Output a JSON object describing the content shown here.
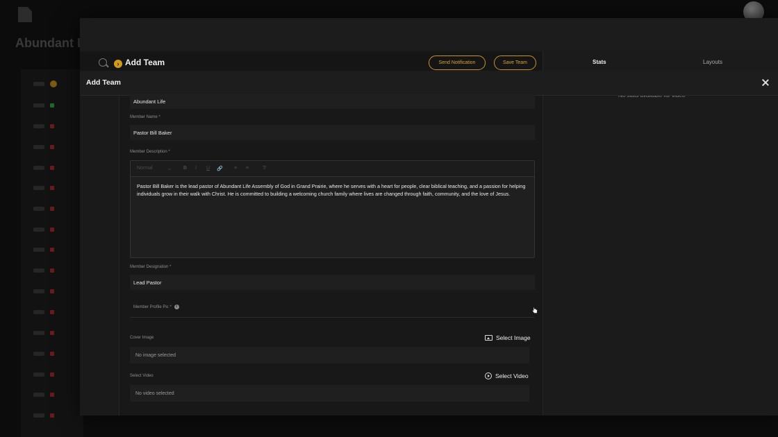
{
  "background": {
    "title": "Abundant Li",
    "list_numbers": [
      "",
      "",
      "",
      "",
      "",
      "",
      "",
      "",
      "",
      "",
      "",
      "",
      "",
      "",
      "",
      ""
    ]
  },
  "modal": {
    "page_title": "Add Team",
    "buttons": {
      "send_notification": "Send Notification",
      "save_team": "Save Team"
    },
    "tabs": {
      "stats": "Stats",
      "layouts": "Layouts"
    },
    "no_stats_text": "No stats available for video",
    "header_title": "Add Team"
  },
  "form": {
    "team_name_value": "Abundant Life",
    "member_name_label": "Member Name *",
    "member_name_value": "Pastor Bill Baker",
    "member_description_label": "Member Description *",
    "toolbar": {
      "format": "Normal",
      "bold": "B",
      "italic": "I",
      "underline": "U",
      "link": "🔗",
      "ordered_list": "≡",
      "bullet_list": "≡",
      "clear": "T̸"
    },
    "member_description_value": "Pastor Bill Baker is the lead pastor of Abundant Life Assembly of God in Grand Prairie, where he serves with a heart for people, clear biblical teaching, and a passion for helping individuals grow in their walk with Christ. He is committed to building a welcoming church family where lives are changed through faith, community, and the love of Jesus.",
    "member_designation_label": "Member Designation *",
    "member_designation_value": "Lead Pastor",
    "member_profile_pic_label": "Member Profile Pic *",
    "cover_image_label": "Cover Image",
    "select_image_label": "Select Image",
    "no_image_text": "No image selected",
    "select_video_section_label": "Select Video",
    "select_video_label": "Select Video",
    "no_video_text": "No video selected"
  },
  "colors": {
    "accent": "#d39a1c",
    "background": "#0c0c0d",
    "modal": "#1a1a1b"
  }
}
